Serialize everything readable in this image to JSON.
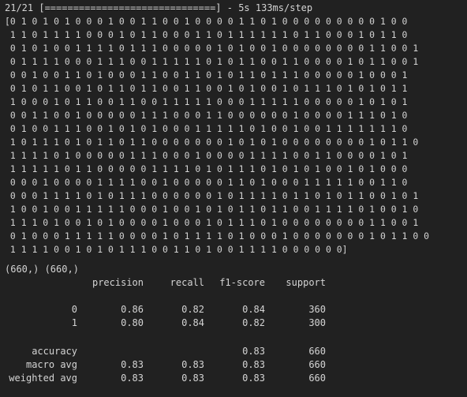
{
  "progress": {
    "line": "21/21 [==============================] - 5s 133ms/step"
  },
  "predictions": [
    "[0 1 0 1 0 1 0 0 0 1 0 0 1 1 0 0 1 0 0 0 0 1 1 0 1 0 0 0 0 0 0 0 0 0 1 0 0",
    " 1 1 0 1 1 1 1 0 0 0 1 0 1 1 0 0 0 1 1 0 1 1 1 1 1 1 0 1 1 0 0 0 1 0 1 1 0",
    " 0 1 0 1 0 0 1 1 1 1 0 1 1 1 0 0 0 0 0 1 0 1 0 0 1 0 0 0 0 0 0 0 0 1 1 0 0 1",
    " 0 1 1 1 1 0 0 0 1 1 1 0 0 1 1 1 1 1 0 1 0 1 1 0 0 1 1 0 0 0 0 1 0 1 1 0 0 1",
    " 0 0 1 0 0 1 1 0 1 0 0 0 1 1 0 0 1 1 0 1 0 1 1 0 1 1 1 0 0 0 0 0 1 0 0 0 1",
    " 0 1 0 1 1 0 0 1 0 1 1 0 1 1 0 0 1 1 0 0 1 0 1 0 0 1 0 1 1 1 0 1 0 1 0 1 1",
    " 1 0 0 0 1 0 1 1 0 0 1 1 0 0 1 1 1 1 1 0 0 0 1 1 1 1 1 0 0 0 0 0 1 0 1 0 1",
    " 0 0 1 1 0 0 1 0 0 0 0 0 1 1 1 0 0 0 1 1 0 0 0 0 0 0 1 0 0 0 0 1 1 1 0 1 0",
    " 0 1 0 0 1 1 1 0 0 1 0 1 0 1 0 0 0 1 1 1 1 1 0 1 0 0 1 0 0 1 1 1 1 1 1 1 0",
    " 1 0 1 1 1 0 1 0 1 1 0 1 1 0 0 0 0 0 0 0 1 0 1 0 1 0 0 0 0 0 0 0 0 1 0 1 1 0",
    " 1 1 1 1 0 1 0 0 0 0 0 1 1 1 0 0 0 1 0 0 0 0 1 1 1 1 0 0 1 1 0 0 0 0 1 0 1",
    " 1 1 1 1 1 0 1 1 0 0 0 0 0 1 1 1 1 0 1 0 1 1 1 0 1 0 1 0 1 0 0 1 0 1 0 0 0",
    " 0 0 0 1 0 0 0 0 1 1 1 1 0 0 1 0 0 0 0 0 1 1 0 1 0 0 0 1 1 1 1 1 0 0 1 1 0",
    " 0 0 0 1 1 1 1 0 1 0 1 1 1 0 0 0 0 0 0 1 0 1 1 1 1 0 1 1 0 1 0 1 1 0 0 1 0 1",
    " 1 0 0 1 0 0 1 1 1 1 1 0 0 0 1 0 0 1 0 1 0 1 1 0 1 1 0 0 1 1 1 1 0 1 0 0 1 0",
    " 1 1 1 0 1 0 0 1 0 1 0 0 0 0 1 0 0 0 1 0 1 1 1 0 1 0 0 0 0 0 0 0 0 1 1 0 0 1",
    " 0 1 0 0 0 1 1 1 1 1 0 0 0 0 1 0 1 1 1 1 0 1 0 0 0 1 0 0 0 0 0 0 0 1 0 1 1 0 0",
    " 1 1 1 1 0 0 1 0 1 0 1 1 1 0 0 1 1 0 1 0 0 1 1 1 1 0 0 0 0 0 0]"
  ],
  "shapes_line": "(660,) (660,)",
  "report": {
    "headers": [
      "precision",
      "recall",
      "f1-score",
      "support"
    ],
    "rows": [
      {
        "label": "0",
        "precision": "0.86",
        "recall": "0.82",
        "f1": "0.84",
        "support": "360"
      },
      {
        "label": "1",
        "precision": "0.80",
        "recall": "0.84",
        "f1": "0.82",
        "support": "300"
      }
    ],
    "summary": [
      {
        "label": "accuracy",
        "precision": "",
        "recall": "",
        "f1": "0.83",
        "support": "660"
      },
      {
        "label": "macro avg",
        "precision": "0.83",
        "recall": "0.83",
        "f1": "0.83",
        "support": "660"
      },
      {
        "label": "weighted avg",
        "precision": "0.83",
        "recall": "0.83",
        "f1": "0.83",
        "support": "660"
      }
    ]
  },
  "colors": {
    "background": "#212121",
    "text": "#d4d4d4"
  }
}
